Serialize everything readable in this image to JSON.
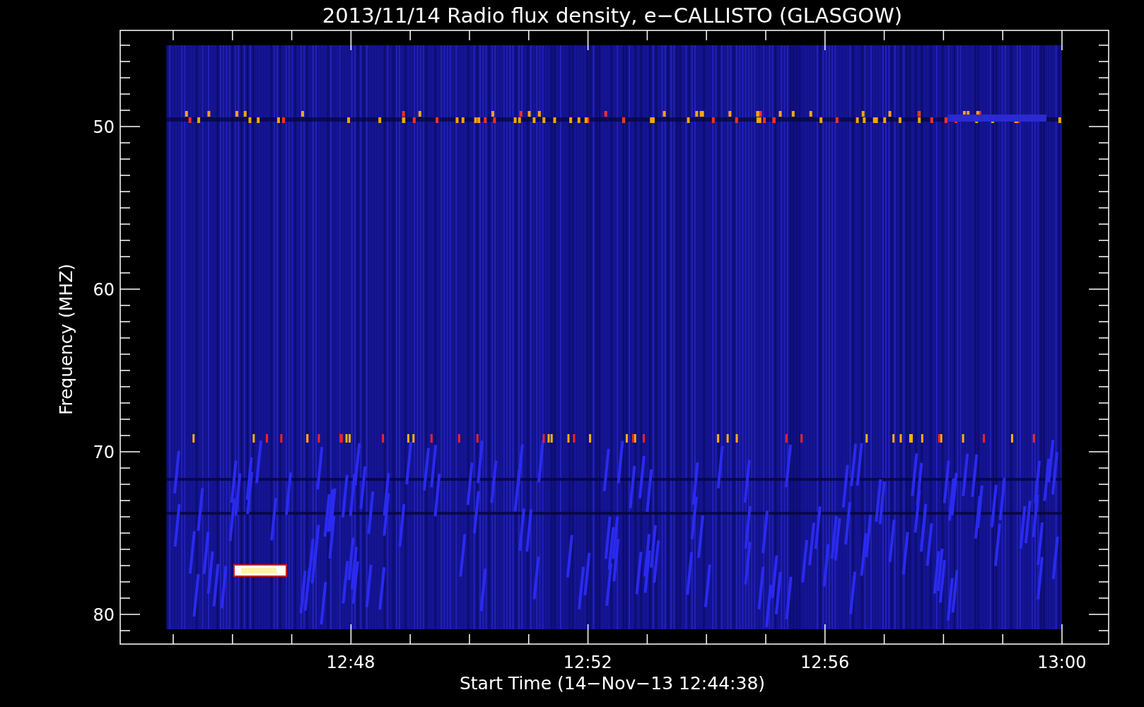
{
  "plot": {
    "title": "2013/11/14  Radio flux density, e−CALLISTO (GLASGOW)",
    "xlabel": "Start Time (14−Nov−13 12:44:38)",
    "ylabel": "Frequency (MHZ)",
    "xtick_labels": [
      "12:48",
      "12:52",
      "12:56",
      "13:00"
    ],
    "ytick_labels": [
      "50",
      "60",
      "70",
      "80"
    ]
  }
}
